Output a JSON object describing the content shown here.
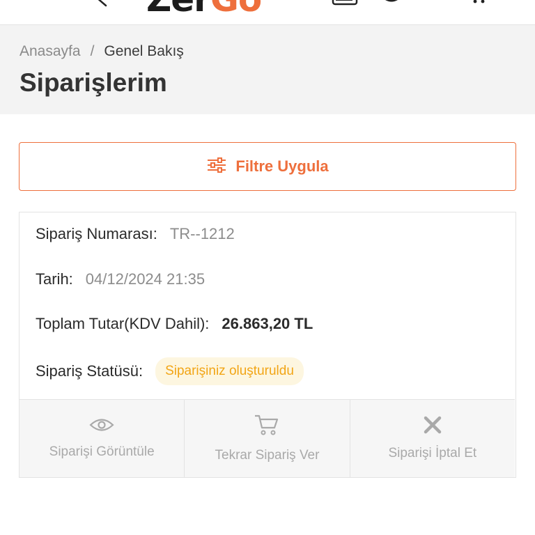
{
  "header": {
    "logo_part1": "Zer",
    "logo_part2": "Go",
    "accent_color": "#ee6f3c"
  },
  "breadcrumb": {
    "home": "Anasayfa",
    "separator": "/",
    "current": "Genel Bakış"
  },
  "page_title": "Siparişlerim",
  "filter_button": {
    "label": "Filtre Uygula",
    "icon": "sliders-icon"
  },
  "order": {
    "number_label": "Sipariş Numarası:",
    "number_value": "TR--1212",
    "date_label": "Tarih:",
    "date_value": "04/12/2024 21:35",
    "total_label": "Toplam Tutar(KDV Dahil):",
    "total_value": "26.863,20 TL",
    "status_label": "Sipariş Statüsü:",
    "status_value": "Siparişiniz oluşturuldu",
    "status_color": "#f2a515"
  },
  "actions": [
    {
      "label": "Siparişi Görüntüle",
      "icon": "eye-icon"
    },
    {
      "label": "Tekrar Sipariş Ver",
      "icon": "cart-icon"
    },
    {
      "label": "Siparişi İptal Et",
      "icon": "close-icon"
    }
  ]
}
